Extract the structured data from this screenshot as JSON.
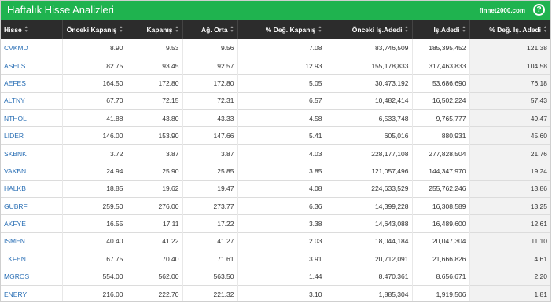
{
  "header": {
    "title": "Haftalık Hisse Analizleri",
    "brand": "finnet2000.com",
    "help_symbol": "?"
  },
  "colors": {
    "header_bg": "#1fb34f",
    "table_header_bg": "#2c2c2c",
    "link": "#2a6fb5",
    "last_col_bg": "#f2f2f2"
  },
  "columns": [
    {
      "label": "Hisse",
      "sort_icon": "sort-icon"
    },
    {
      "label": "Önceki Kapanış",
      "sort_icon": "sort-icon"
    },
    {
      "label": "Kapanış",
      "sort_icon": "sort-icon"
    },
    {
      "label": "Ağ. Orta",
      "sort_icon": "sort-icon"
    },
    {
      "label": "% Değ. Kapanış",
      "sort_icon": "sort-icon"
    },
    {
      "label": "Önceki İş.Adedi",
      "sort_icon": "sort-icon"
    },
    {
      "label": "İş.Adedi",
      "sort_icon": "sort-icon"
    },
    {
      "label": "% Değ. İş. Adedi",
      "sort_icon": "sort-icon"
    }
  ],
  "rows": [
    [
      "CVKMD",
      "8.90",
      "9.53",
      "9.56",
      "7.08",
      "83,746,509",
      "185,395,452",
      "121.38"
    ],
    [
      "ASELS",
      "82.75",
      "93.45",
      "92.57",
      "12.93",
      "155,178,833",
      "317,463,833",
      "104.58"
    ],
    [
      "AEFES",
      "164.50",
      "172.80",
      "172.80",
      "5.05",
      "30,473,192",
      "53,686,690",
      "76.18"
    ],
    [
      "ALTNY",
      "67.70",
      "72.15",
      "72.31",
      "6.57",
      "10,482,414",
      "16,502,224",
      "57.43"
    ],
    [
      "NTHOL",
      "41.88",
      "43.80",
      "43.33",
      "4.58",
      "6,533,748",
      "9,765,777",
      "49.47"
    ],
    [
      "LIDER",
      "146.00",
      "153.90",
      "147.66",
      "5.41",
      "605,016",
      "880,931",
      "45.60"
    ],
    [
      "SKBNK",
      "3.72",
      "3.87",
      "3.87",
      "4.03",
      "228,177,108",
      "277,828,504",
      "21.76"
    ],
    [
      "VAKBN",
      "24.94",
      "25.90",
      "25.85",
      "3.85",
      "121,057,496",
      "144,347,970",
      "19.24"
    ],
    [
      "HALKB",
      "18.85",
      "19.62",
      "19.47",
      "4.08",
      "224,633,529",
      "255,762,246",
      "13.86"
    ],
    [
      "GUBRF",
      "259.50",
      "276.00",
      "273.77",
      "6.36",
      "14,399,228",
      "16,308,589",
      "13.25"
    ],
    [
      "AKFYE",
      "16.55",
      "17.11",
      "17.22",
      "3.38",
      "14,643,088",
      "16,489,600",
      "12.61"
    ],
    [
      "ISMEN",
      "40.40",
      "41.22",
      "41.27",
      "2.03",
      "18,044,184",
      "20,047,304",
      "11.10"
    ],
    [
      "TKFEN",
      "67.75",
      "70.40",
      "71.61",
      "3.91",
      "20,712,091",
      "21,666,826",
      "4.61"
    ],
    [
      "MGROS",
      "554.00",
      "562.00",
      "563.50",
      "1.44",
      "8,470,361",
      "8,656,671",
      "2.20"
    ],
    [
      "ENERY",
      "216.00",
      "222.70",
      "221.32",
      "3.10",
      "1,885,304",
      "1,919,506",
      "1.81"
    ]
  ]
}
